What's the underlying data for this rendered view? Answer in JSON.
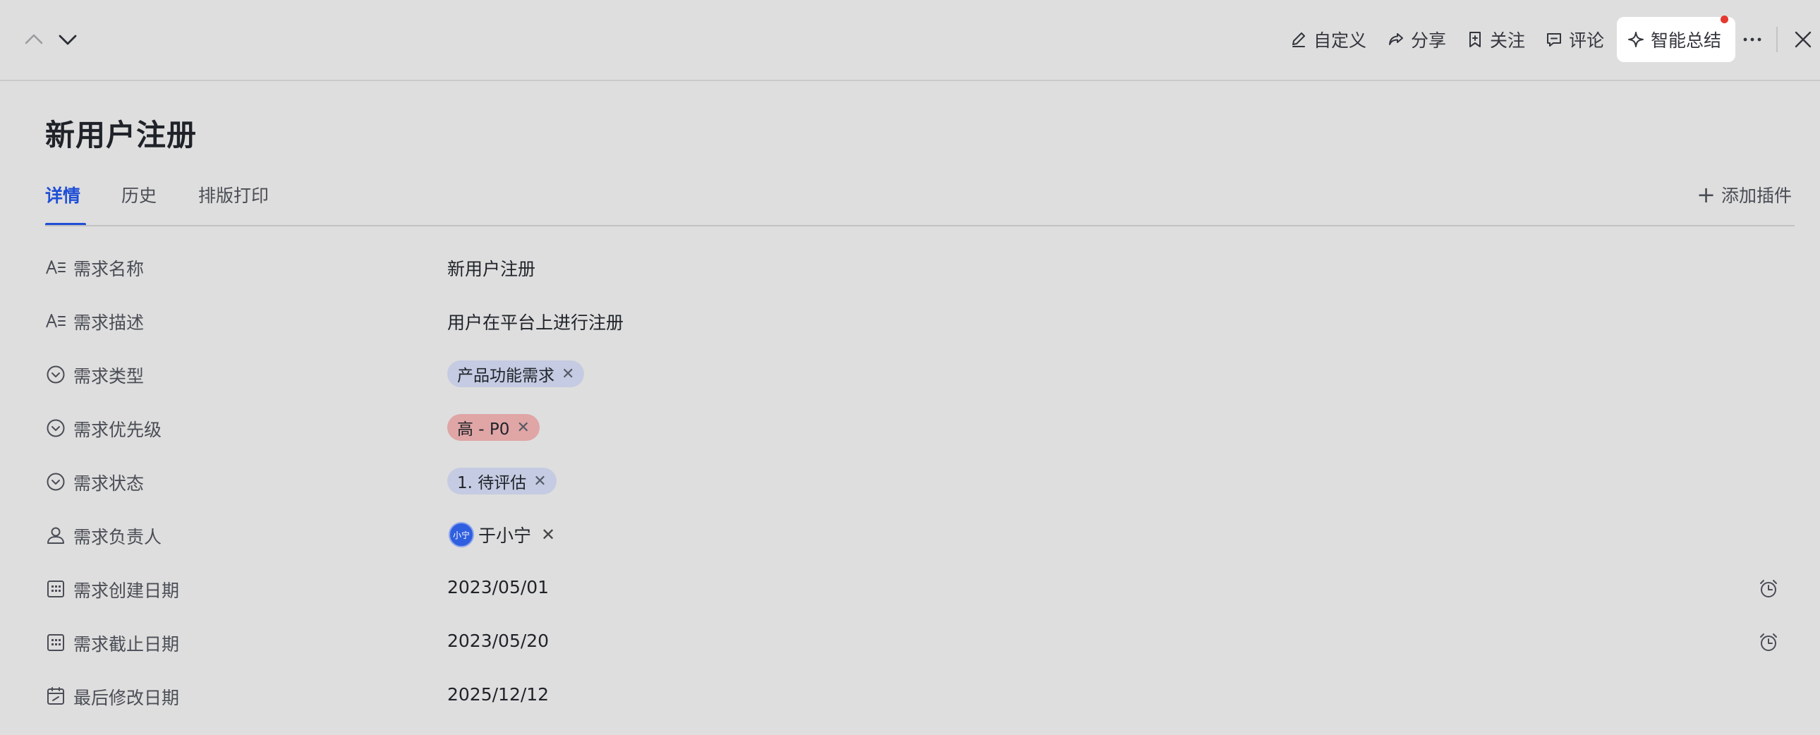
{
  "toolbar": {
    "customize": "自定义",
    "share": "分享",
    "follow": "关注",
    "comment": "评论",
    "ai_summary": "智能总结"
  },
  "title": "新用户注册",
  "tabs": [
    {
      "label": "详情",
      "active": true
    },
    {
      "label": "历史",
      "active": false
    },
    {
      "label": "排版打印",
      "active": false
    }
  ],
  "add_plugin": "添加插件",
  "fields": {
    "name": {
      "label": "需求名称",
      "value": "新用户注册",
      "icon": "text-field-icon"
    },
    "description": {
      "label": "需求描述",
      "value": "用户在平台上进行注册",
      "icon": "text-field-icon"
    },
    "type": {
      "label": "需求类型",
      "value": "产品功能需求",
      "icon": "select-field-icon",
      "color": "#c5cbe2"
    },
    "priority": {
      "label": "需求优先级",
      "value": "高 - P0",
      "icon": "select-field-icon",
      "color": "#e0a5a5"
    },
    "status": {
      "label": "需求状态",
      "value": "1. 待评估",
      "icon": "select-field-icon",
      "color": "#c5cbe2"
    },
    "owner": {
      "label": "需求负责人",
      "value": "于小宁",
      "avatar_text": "小宁",
      "icon": "person-field-icon"
    },
    "created": {
      "label": "需求创建日期",
      "value": "2023/05/01",
      "icon": "date-field-icon"
    },
    "deadline": {
      "label": "需求截止日期",
      "value": "2023/05/20",
      "icon": "date-field-icon"
    },
    "modified": {
      "label": "最后修改日期",
      "value": "2025/12/12",
      "icon": "modified-date-icon"
    }
  },
  "colors": {
    "accent": "#1f4fd6",
    "background": "#dedede",
    "notification_dot": "#e5382f"
  }
}
